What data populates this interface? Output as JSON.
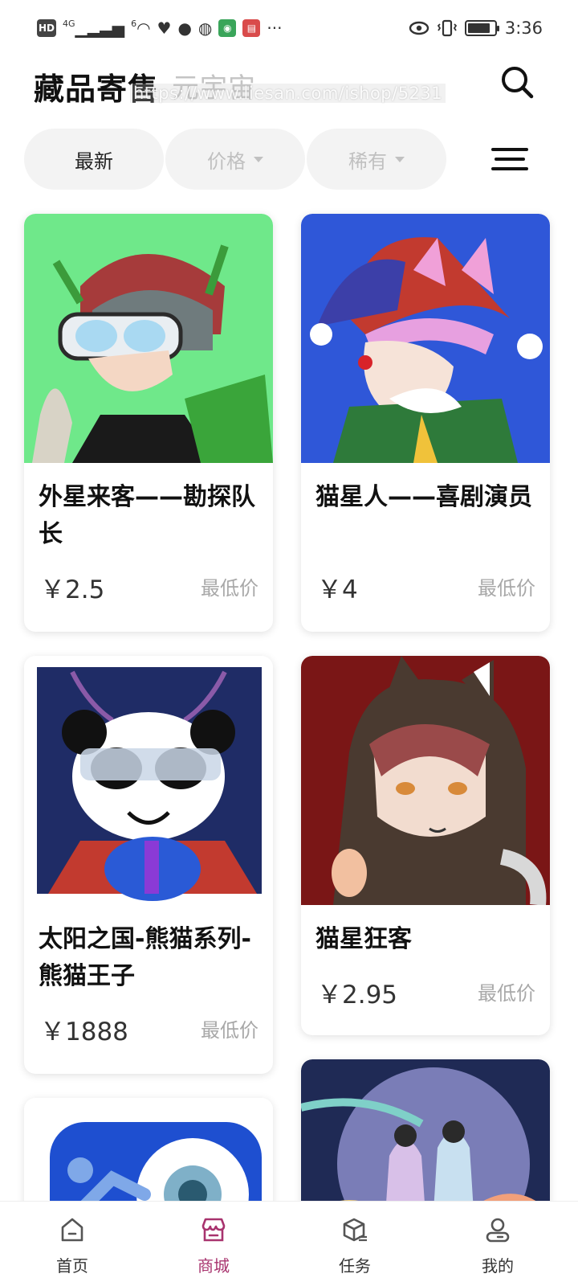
{
  "status_bar": {
    "network_label": "HD",
    "signal_label": "4G",
    "wifi_label": "6",
    "time": "3:36",
    "battery_level": 0.85,
    "icons": [
      "hd-icon",
      "signal-icon",
      "wifi-icon",
      "heart-icon",
      "chat-icon",
      "browser-icon",
      "map-icon",
      "book-icon",
      "more-icon",
      "eye-icon",
      "vibrate-icon",
      "battery-icon"
    ]
  },
  "header": {
    "title": "藏品寄售",
    "subtitle": "元宇宙",
    "watermark": "https://www.liesan.com/ishop/5231"
  },
  "filters": {
    "items": [
      {
        "label": "最新",
        "active": true
      },
      {
        "label": "价格",
        "active": false
      },
      {
        "label": "稀有",
        "active": false
      }
    ]
  },
  "products": [
    {
      "name": "外星来客——勘探队长",
      "price": "￥2.5",
      "tag": "最低价"
    },
    {
      "name": "猫星人——喜剧演员",
      "price": "￥4",
      "tag": "最低价"
    },
    {
      "name": "太阳之国-熊猫系列-熊猫王子",
      "price": "￥1888",
      "tag": "最低价"
    },
    {
      "name": "猫星狂客",
      "price": "￥2.95",
      "tag": "最低价"
    }
  ],
  "bottom_nav": {
    "items": [
      {
        "label": "首页",
        "icon": "home-icon"
      },
      {
        "label": "商城",
        "icon": "store-icon",
        "active": true
      },
      {
        "label": "任务",
        "icon": "task-box-icon"
      },
      {
        "label": "我的",
        "icon": "user-icon"
      }
    ]
  },
  "colors": {
    "accent": "#a8336e",
    "muted": "#c0c0c0",
    "chip_bg": "#f3f3f3"
  }
}
